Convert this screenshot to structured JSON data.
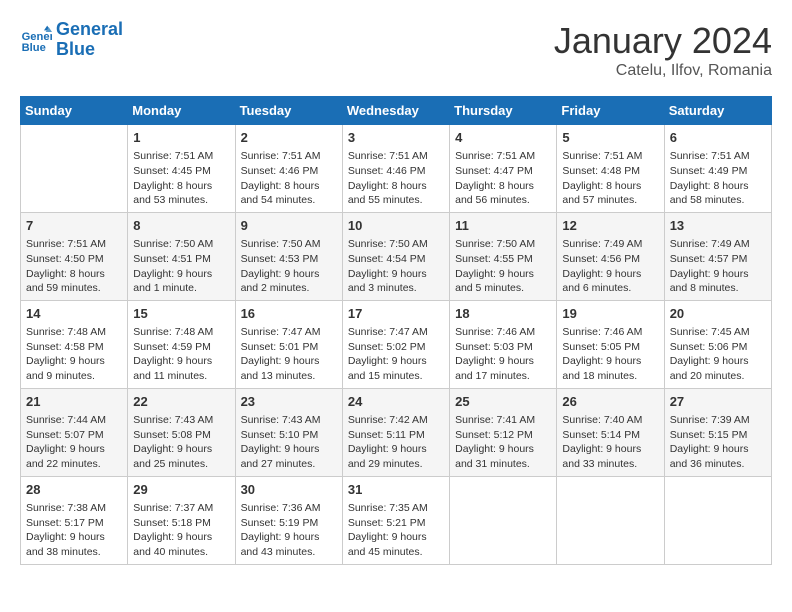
{
  "header": {
    "logo_line1": "General",
    "logo_line2": "Blue",
    "title": "January 2024",
    "subtitle": "Catelu, Ilfov, Romania"
  },
  "days_of_week": [
    "Sunday",
    "Monday",
    "Tuesday",
    "Wednesday",
    "Thursday",
    "Friday",
    "Saturday"
  ],
  "weeks": [
    [
      {
        "day": "",
        "info": ""
      },
      {
        "day": "1",
        "info": "Sunrise: 7:51 AM\nSunset: 4:45 PM\nDaylight: 8 hours\nand 53 minutes."
      },
      {
        "day": "2",
        "info": "Sunrise: 7:51 AM\nSunset: 4:46 PM\nDaylight: 8 hours\nand 54 minutes."
      },
      {
        "day": "3",
        "info": "Sunrise: 7:51 AM\nSunset: 4:46 PM\nDaylight: 8 hours\nand 55 minutes."
      },
      {
        "day": "4",
        "info": "Sunrise: 7:51 AM\nSunset: 4:47 PM\nDaylight: 8 hours\nand 56 minutes."
      },
      {
        "day": "5",
        "info": "Sunrise: 7:51 AM\nSunset: 4:48 PM\nDaylight: 8 hours\nand 57 minutes."
      },
      {
        "day": "6",
        "info": "Sunrise: 7:51 AM\nSunset: 4:49 PM\nDaylight: 8 hours\nand 58 minutes."
      }
    ],
    [
      {
        "day": "7",
        "info": "Sunrise: 7:51 AM\nSunset: 4:50 PM\nDaylight: 8 hours\nand 59 minutes."
      },
      {
        "day": "8",
        "info": "Sunrise: 7:50 AM\nSunset: 4:51 PM\nDaylight: 9 hours\nand 1 minute."
      },
      {
        "day": "9",
        "info": "Sunrise: 7:50 AM\nSunset: 4:53 PM\nDaylight: 9 hours\nand 2 minutes."
      },
      {
        "day": "10",
        "info": "Sunrise: 7:50 AM\nSunset: 4:54 PM\nDaylight: 9 hours\nand 3 minutes."
      },
      {
        "day": "11",
        "info": "Sunrise: 7:50 AM\nSunset: 4:55 PM\nDaylight: 9 hours\nand 5 minutes."
      },
      {
        "day": "12",
        "info": "Sunrise: 7:49 AM\nSunset: 4:56 PM\nDaylight: 9 hours\nand 6 minutes."
      },
      {
        "day": "13",
        "info": "Sunrise: 7:49 AM\nSunset: 4:57 PM\nDaylight: 9 hours\nand 8 minutes."
      }
    ],
    [
      {
        "day": "14",
        "info": "Sunrise: 7:48 AM\nSunset: 4:58 PM\nDaylight: 9 hours\nand 9 minutes."
      },
      {
        "day": "15",
        "info": "Sunrise: 7:48 AM\nSunset: 4:59 PM\nDaylight: 9 hours\nand 11 minutes."
      },
      {
        "day": "16",
        "info": "Sunrise: 7:47 AM\nSunset: 5:01 PM\nDaylight: 9 hours\nand 13 minutes."
      },
      {
        "day": "17",
        "info": "Sunrise: 7:47 AM\nSunset: 5:02 PM\nDaylight: 9 hours\nand 15 minutes."
      },
      {
        "day": "18",
        "info": "Sunrise: 7:46 AM\nSunset: 5:03 PM\nDaylight: 9 hours\nand 17 minutes."
      },
      {
        "day": "19",
        "info": "Sunrise: 7:46 AM\nSunset: 5:05 PM\nDaylight: 9 hours\nand 18 minutes."
      },
      {
        "day": "20",
        "info": "Sunrise: 7:45 AM\nSunset: 5:06 PM\nDaylight: 9 hours\nand 20 minutes."
      }
    ],
    [
      {
        "day": "21",
        "info": "Sunrise: 7:44 AM\nSunset: 5:07 PM\nDaylight: 9 hours\nand 22 minutes."
      },
      {
        "day": "22",
        "info": "Sunrise: 7:43 AM\nSunset: 5:08 PM\nDaylight: 9 hours\nand 25 minutes."
      },
      {
        "day": "23",
        "info": "Sunrise: 7:43 AM\nSunset: 5:10 PM\nDaylight: 9 hours\nand 27 minutes."
      },
      {
        "day": "24",
        "info": "Sunrise: 7:42 AM\nSunset: 5:11 PM\nDaylight: 9 hours\nand 29 minutes."
      },
      {
        "day": "25",
        "info": "Sunrise: 7:41 AM\nSunset: 5:12 PM\nDaylight: 9 hours\nand 31 minutes."
      },
      {
        "day": "26",
        "info": "Sunrise: 7:40 AM\nSunset: 5:14 PM\nDaylight: 9 hours\nand 33 minutes."
      },
      {
        "day": "27",
        "info": "Sunrise: 7:39 AM\nSunset: 5:15 PM\nDaylight: 9 hours\nand 36 minutes."
      }
    ],
    [
      {
        "day": "28",
        "info": "Sunrise: 7:38 AM\nSunset: 5:17 PM\nDaylight: 9 hours\nand 38 minutes."
      },
      {
        "day": "29",
        "info": "Sunrise: 7:37 AM\nSunset: 5:18 PM\nDaylight: 9 hours\nand 40 minutes."
      },
      {
        "day": "30",
        "info": "Sunrise: 7:36 AM\nSunset: 5:19 PM\nDaylight: 9 hours\nand 43 minutes."
      },
      {
        "day": "31",
        "info": "Sunrise: 7:35 AM\nSunset: 5:21 PM\nDaylight: 9 hours\nand 45 minutes."
      },
      {
        "day": "",
        "info": ""
      },
      {
        "day": "",
        "info": ""
      },
      {
        "day": "",
        "info": ""
      }
    ]
  ]
}
